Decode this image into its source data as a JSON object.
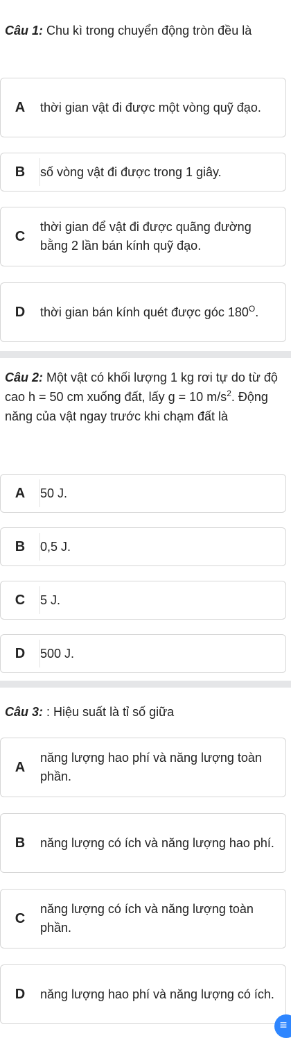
{
  "q1": {
    "label": "Câu 1:",
    "text": " Chu kì trong chuyển động tròn đều là",
    "options": [
      {
        "letter": "A",
        "text": "thời gian vật đi được một vòng quỹ đạo."
      },
      {
        "letter": "B",
        "text": "số vòng vật đi được trong 1 giây."
      },
      {
        "letter": "C",
        "text": "thời gian để vật đi được quãng đường bằng 2 lần bán kính quỹ đạo."
      },
      {
        "letter": "D",
        "text_main": "thời gian bán kính quét được góc 180",
        "text_sup": "O",
        "text_end": "."
      }
    ]
  },
  "q2": {
    "label": "Câu 2:",
    "text_a": " Một vật có khối lượng 1 kg rơi tự do từ độ cao h = 50 cm xuống đất, lấy g = 10 m/s",
    "text_sup": "2",
    "text_b": ". Động năng của vật ngay trước khi chạm đất là",
    "options": [
      {
        "letter": "A",
        "text": "50 J."
      },
      {
        "letter": "B",
        "text": "0,5 J."
      },
      {
        "letter": "C",
        "text": "5 J."
      },
      {
        "letter": "D",
        "text": "500 J."
      }
    ]
  },
  "q3": {
    "label": "Câu 3:",
    "text": " : Hiệu suất là tỉ số giữa",
    "options": [
      {
        "letter": "A",
        "text": "năng lượng hao phí và năng lượng toàn phần."
      },
      {
        "letter": "B",
        "text": "năng lượng có ích và năng lượng hao phí."
      },
      {
        "letter": "C",
        "text": "năng lượng có ích và năng lượng toàn phần."
      },
      {
        "letter": "D",
        "text": "năng lượng hao phí và năng lượng có ích."
      }
    ]
  },
  "menu_icon": "list-menu-icon",
  "colors": {
    "accent": "#2e86ff",
    "divider": "#e5e6e8",
    "border": "#d6d6d6"
  }
}
